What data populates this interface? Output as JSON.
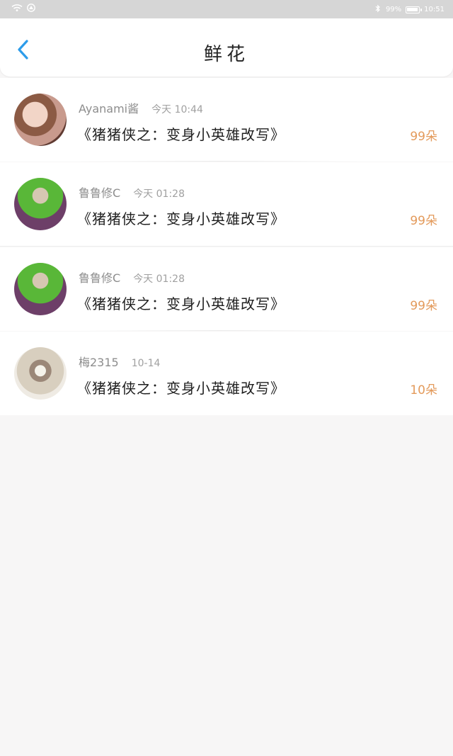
{
  "status_bar": {
    "battery_text": "99%",
    "time": "10:51",
    "battery_level": 0.99,
    "icons": [
      "wifi-icon",
      "signal-icon",
      "bluetooth-icon",
      "battery-icon"
    ]
  },
  "header": {
    "title": "鲜花",
    "back_icon": "chevron-left-icon"
  },
  "items": [
    {
      "name": "Ayanami酱",
      "time": "今天 10:44",
      "book": "《猪猪侠之：变身小英雄改写》",
      "count": "99朵"
    },
    {
      "name": "鲁鲁修C",
      "time": "今天 01:28",
      "book": "《猪猪侠之：变身小英雄改写》",
      "count": "99朵"
    },
    {
      "name": "鲁鲁修C",
      "time": "今天 01:28",
      "book": "《猪猪侠之：变身小英雄改写》",
      "count": "99朵"
    },
    {
      "name": "梅2315",
      "time": "10-14",
      "book": "《猪猪侠之：变身小英雄改写》",
      "count": "10朵"
    }
  ],
  "colors": {
    "accent": "#2d9cea",
    "count": "#e39a5b",
    "title": "#222222",
    "meta": "#8d8d8d",
    "background": "#f7f6f6"
  }
}
